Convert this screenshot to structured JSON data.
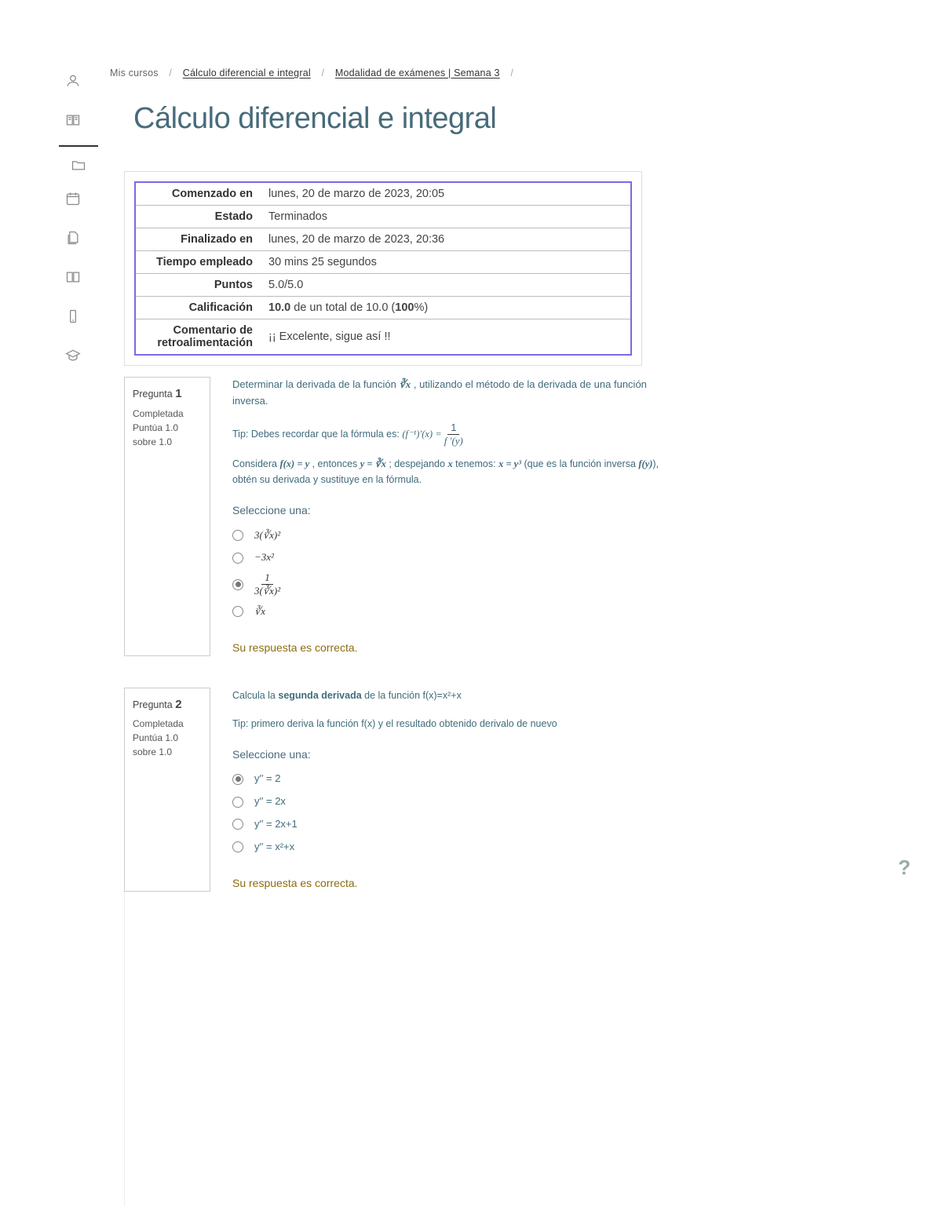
{
  "breadcrumb": {
    "item1": "Mis cursos",
    "item2": "Cálculo diferencial e integral",
    "item3": "Modalidad de exámenes | Semana 3"
  },
  "page_title": "Cálculo diferencial e integral",
  "summary": {
    "rows": [
      {
        "label": "Comenzado en",
        "value": "lunes, 20 de marzo de 2023, 20:05"
      },
      {
        "label": "Estado",
        "value": "Terminados"
      },
      {
        "label": "Finalizado en",
        "value": "lunes, 20 de marzo de 2023, 20:36"
      },
      {
        "label": "Tiempo empleado",
        "value": "30 mins 25 segundos"
      },
      {
        "label": "Puntos",
        "value": "5.0/5.0"
      },
      {
        "label": "Calificación",
        "value_prefix": "10.0",
        "value_mid": " de un total de 10.0 (",
        "value_pct": "100",
        "value_suffix": "%)"
      },
      {
        "label": "Comentario de retroalimentación",
        "value": "¡¡ Excelente, sigue así !!"
      }
    ]
  },
  "q1": {
    "label_prefix": "Pregunta ",
    "number": "1",
    "status": "Completada",
    "score": "Puntúa 1.0 sobre 1.0",
    "stem_a": "Determinar la derivada de la función ",
    "stem_root": "∛x",
    "stem_b": " , utilizando el método de la derivada de una función inversa.",
    "tip_prefix": "Tip: Debes recordar que la fórmula es: ",
    "formula_lhs": "(f⁻¹)′(x) = ",
    "formula_num": "1",
    "formula_den": "f ′(y)",
    "consider_a": "Considera ",
    "consider_eq1": "f(x) = y",
    "consider_b": " , entonces ",
    "consider_eq2": "y = ∛x",
    "consider_c": " ; despejando ",
    "consider_x": "x",
    "consider_d": " tenemos: ",
    "consider_eq3": "x = y³",
    "consider_e": " (que es la función inversa ",
    "consider_fy": "f(y)",
    "consider_f": "), obtén su derivada y sustituye en la fórmula.",
    "select_label": "Seleccione una:",
    "opts": [
      {
        "text": "3(∛x)²",
        "selected": false
      },
      {
        "text": "−3x²",
        "selected": false
      },
      {
        "text_num": "1",
        "text_den": "3(∛x)²",
        "selected": true,
        "fraction": true
      },
      {
        "text": "∛x",
        "selected": false
      }
    ],
    "feedback": "Su respuesta es correcta."
  },
  "q2": {
    "label_prefix": "Pregunta ",
    "number": "2",
    "status": "Completada",
    "score": "Puntúa 1.0 sobre 1.0",
    "stem_a": "Calcula la ",
    "stem_bold": "segunda derivada",
    "stem_b": " de la función f(x)=x²+x",
    "tip": "Tip: primero deriva la función f(x) y el resultado obtenido derivalo de nuevo",
    "select_label": "Seleccione una:",
    "opts": [
      {
        "text": "y′′ = 2",
        "selected": true
      },
      {
        "text": "y′′ = 2x",
        "selected": false
      },
      {
        "text": "y′′ = 2x+1",
        "selected": false
      },
      {
        "text": "y′′ = x²+x",
        "selected": false
      }
    ],
    "feedback": "Su respuesta es correcta."
  },
  "help_glyph": "?"
}
